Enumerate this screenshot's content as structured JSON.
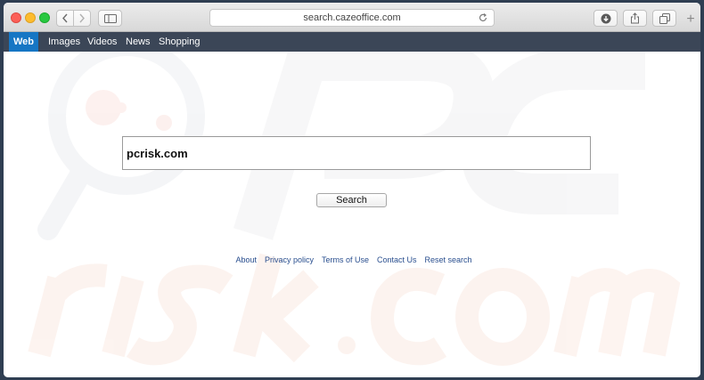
{
  "browser": {
    "url": "search.cazeoffice.com",
    "new_tab_label": "+"
  },
  "nav": {
    "items": [
      {
        "label": "Web",
        "active": true
      },
      {
        "label": "Images",
        "active": false
      },
      {
        "label": "Videos",
        "active": false
      },
      {
        "label": "News",
        "active": false
      },
      {
        "label": "Shopping",
        "active": false
      }
    ]
  },
  "search": {
    "value": "pcrisk.com",
    "button_label": "Search"
  },
  "footer": {
    "links": [
      "About",
      "Privacy policy",
      "Terms of Use",
      "Contact Us",
      "Reset search"
    ]
  },
  "colors": {
    "nav_bg": "#3b4657",
    "nav_active": "#1676c4",
    "link": "#2a4f8f"
  }
}
